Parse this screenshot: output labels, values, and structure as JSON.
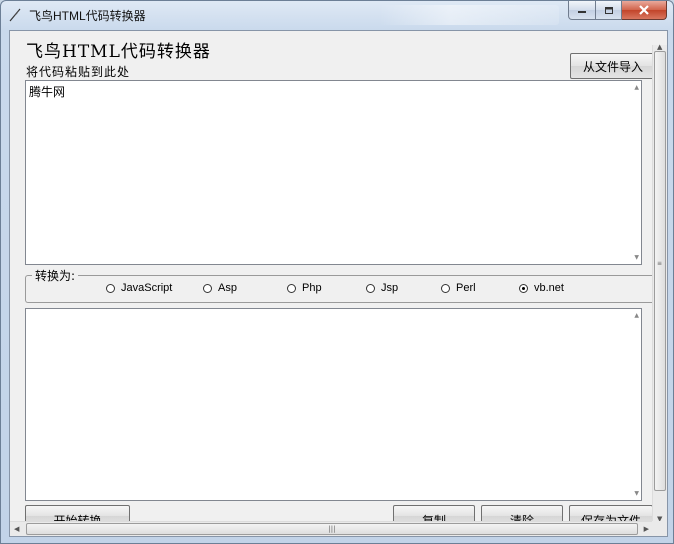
{
  "window": {
    "title": "飞鸟HTML代码转换器"
  },
  "app": {
    "heading": "飞鸟HTML代码转换器",
    "paste_label": "将代码粘贴到此处",
    "import_button": "从文件导入"
  },
  "input_box": {
    "value": "腾牛网"
  },
  "convert": {
    "group_label": "转换为:",
    "options": [
      {
        "label": "JavaScript",
        "selected": false
      },
      {
        "label": "Asp",
        "selected": false
      },
      {
        "label": "Php",
        "selected": false
      },
      {
        "label": "Jsp",
        "selected": false
      },
      {
        "label": "Perl",
        "selected": false
      },
      {
        "label": "vb.net",
        "selected": true
      }
    ]
  },
  "output_box": {
    "value": ""
  },
  "buttons": {
    "start": "开始转换",
    "copy": "复制",
    "clear": "清除",
    "save": "保存为文件"
  },
  "colors": {
    "client_bg": "#f0f0f0",
    "close_button": "#c2442a",
    "frame": "#c9d9ec"
  }
}
